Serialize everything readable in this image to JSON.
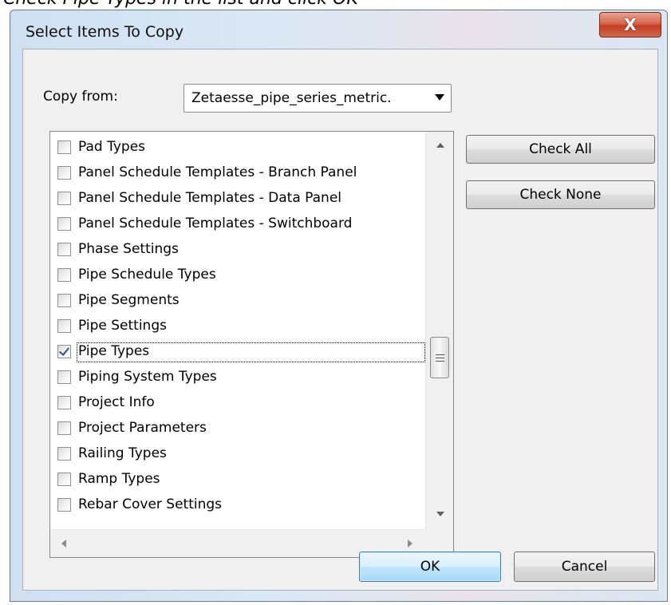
{
  "caption": "Check Pipe Types in the list and click OK",
  "dialog": {
    "title": "Select Items To Copy",
    "close_glyph": "X"
  },
  "copy_from": {
    "label": "Copy from:",
    "value": "Zetaesse_pipe_series_metric."
  },
  "items": [
    {
      "label": "Pad Types",
      "checked": false
    },
    {
      "label": "Panel Schedule Templates - Branch Panel",
      "checked": false
    },
    {
      "label": "Panel Schedule Templates - Data Panel",
      "checked": false
    },
    {
      "label": "Panel Schedule Templates - Switchboard",
      "checked": false
    },
    {
      "label": "Phase Settings",
      "checked": false
    },
    {
      "label": "Pipe Schedule Types",
      "checked": false
    },
    {
      "label": "Pipe Segments",
      "checked": false
    },
    {
      "label": "Pipe Settings",
      "checked": false
    },
    {
      "label": "Pipe Types",
      "checked": true,
      "focused": true
    },
    {
      "label": "Piping System Types",
      "checked": false
    },
    {
      "label": "Project Info",
      "checked": false
    },
    {
      "label": "Project Parameters",
      "checked": false
    },
    {
      "label": "Railing Types",
      "checked": false
    },
    {
      "label": "Ramp Types",
      "checked": false
    },
    {
      "label": "Rebar Cover Settings",
      "checked": false
    }
  ],
  "buttons": {
    "check_all": "Check All",
    "check_none": "Check None",
    "ok": "OK",
    "cancel": "Cancel"
  }
}
